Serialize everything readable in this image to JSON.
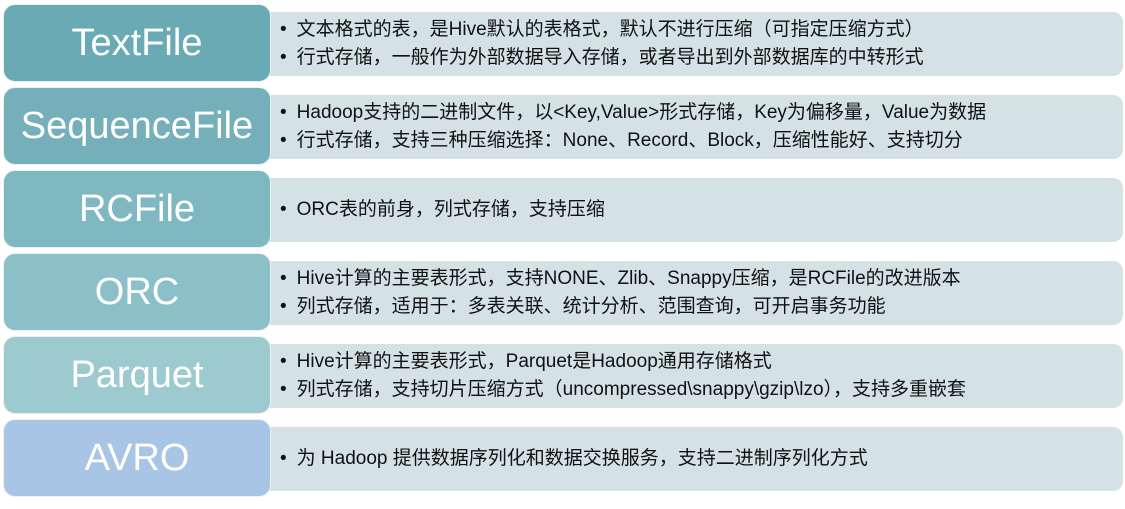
{
  "rows": [
    {
      "title": "TextFile",
      "color": "#6aaab4",
      "bullets": [
        "文本格式的表，是Hive默认的表格式，默认不进行压缩（可指定压缩方式）",
        "行式存储，一般作为外部数据导入存储，或者导出到外部数据库的中转形式"
      ]
    },
    {
      "title": "SequenceFile",
      "color": "#75b0ba",
      "bullets": [
        "Hadoop支持的二进制文件，以<Key,Value>形式存储，Key为偏移量，Value为数据",
        "行式存储，支持三种压缩选择：None、Record、Block，压缩性能好、支持切分"
      ]
    },
    {
      "title": "RCFile",
      "color": "#80b8c1",
      "bullets": [
        "ORC表的前身，列式存储，支持压缩"
      ]
    },
    {
      "title": "ORC",
      "color": "#8bc0c8",
      "bullets": [
        "Hive计算的主要表形式，支持NONE、Zlib、Snappy压缩，是RCFile的改进版本",
        "列式存储，适用于：多表关联、统计分析、范围查询，可开启事务功能"
      ]
    },
    {
      "title": "Parquet",
      "color": "#9dcacf",
      "bullets": [
        "Hive计算的主要表形式，Parquet是Hadoop通用存储格式",
        "列式存储，支持切片压缩方式（uncompressed\\snappy\\gzip\\lzo），支持多重嵌套"
      ]
    },
    {
      "title": "AVRO",
      "color": "#a8c5e6",
      "bullets": [
        "为 Hadoop 提供数据序列化和数据交换服务，支持二进制序列化方式"
      ]
    }
  ]
}
